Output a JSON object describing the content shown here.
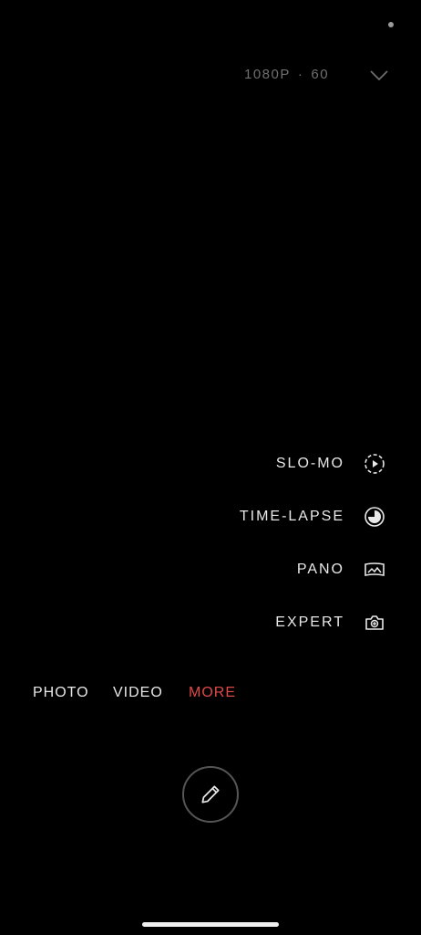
{
  "top_bar": {
    "resolution": "1080P",
    "separator": "·",
    "frame_rate": "60",
    "chevron_icon": "chevron-down-icon"
  },
  "mode_list": {
    "items": [
      {
        "label": "SLO-MO",
        "icon": "slow-motion-icon"
      },
      {
        "label": "TIME-LAPSE",
        "icon": "time-lapse-icon"
      },
      {
        "label": "PANO",
        "icon": "panorama-icon"
      },
      {
        "label": "EXPERT",
        "icon": "expert-camera-icon"
      }
    ]
  },
  "tabs": {
    "items": [
      {
        "label": "PHOTO"
      },
      {
        "label": "VIDEO"
      },
      {
        "label": "MORE",
        "active": true
      }
    ],
    "active_color": "#e04848"
  },
  "edit_button": {
    "icon": "pencil-icon"
  }
}
